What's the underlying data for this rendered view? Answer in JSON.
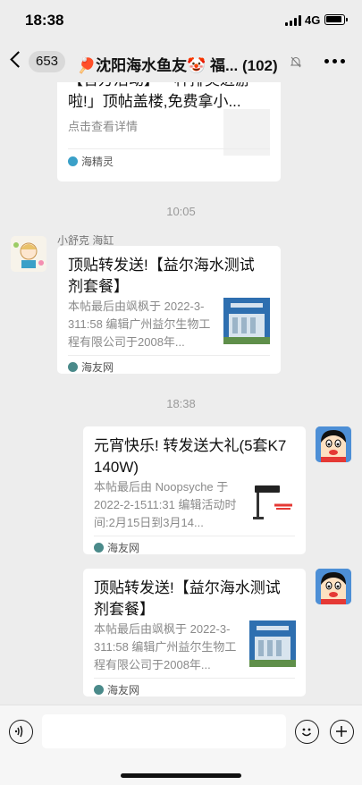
{
  "status_bar": {
    "time": "18:38",
    "network": "4G",
    "battery_level": 0.85
  },
  "header": {
    "unread_count": "653",
    "title": "🏓沈阳海水鱼友🤡 福... (102)",
    "icons": {
      "back": "chevron-left-icon",
      "mute": "bell-off-icon",
      "more": "more-dots-icon"
    }
  },
  "messages": {
    "card0": {
      "title_partial": "【官方活动】一种排奖进游",
      "title_line2": "啦!」顶帖盖楼,免费拿小...",
      "desc": "点击查看详情",
      "source": "海精灵"
    },
    "time1": "10:05",
    "msg1": {
      "sender": "小舒克 海缸",
      "title": "顶贴转发送!【益尔海水测试剂套餐】",
      "desc": "本帖最后由飒枫于 2022-3-311:58 编辑广州益尔生物工程有限公司于2008年...",
      "source": "海友网"
    },
    "time2": "18:38",
    "msg2": {
      "title": "元宵快乐! 转发送大礼(5套K7 140W)",
      "desc": "本帖最后由 Noopsyche 于2022-2-1511:31 编辑活动时间:2月15日到3月14...",
      "source": "海友网"
    },
    "msg3": {
      "title": "顶贴转发送!【益尔海水测试剂套餐】",
      "desc": "本帖最后由飒枫于 2022-3-311:58 编辑广州益尔生物工程有限公司于2008年...",
      "source": "海友网"
    }
  },
  "input_bar": {
    "voice_icon": "voice-icon",
    "emoji_icon": "emoji-icon",
    "plus_icon": "plus-icon"
  }
}
